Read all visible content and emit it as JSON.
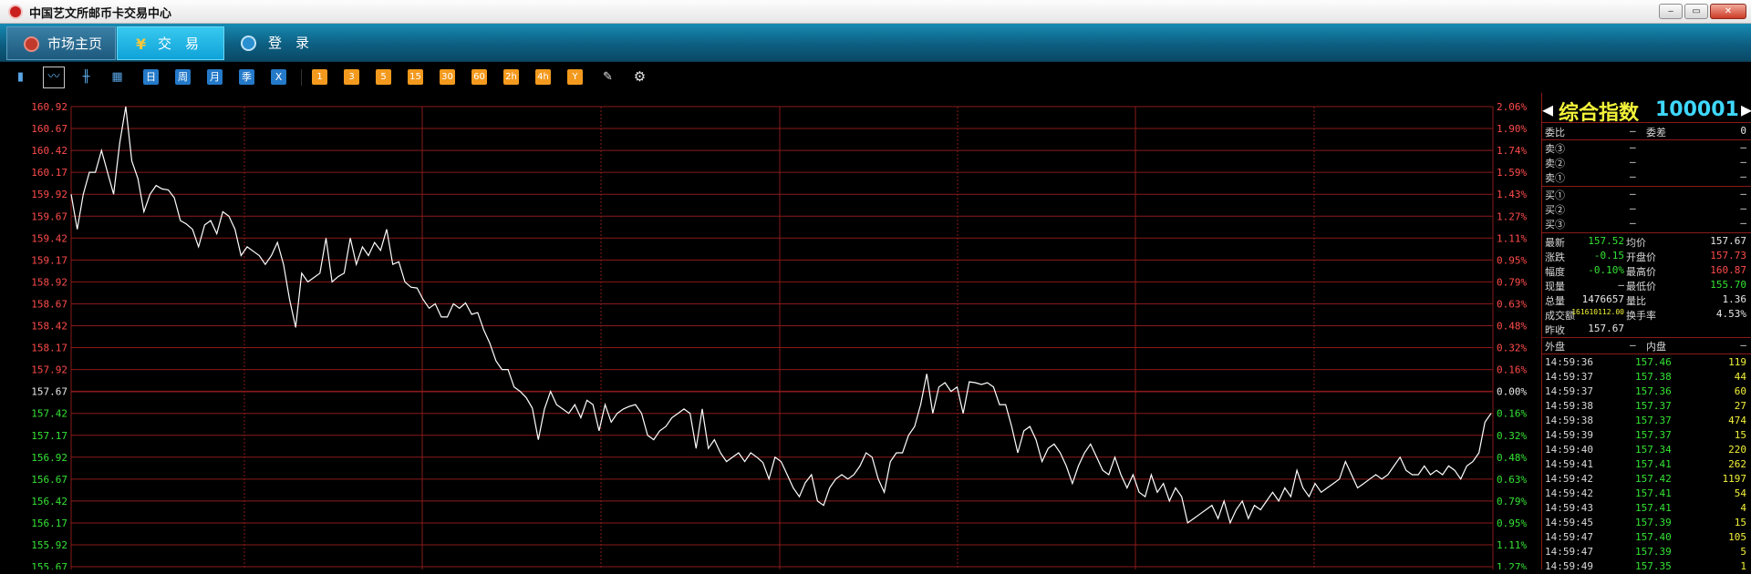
{
  "window": {
    "title": "中国艺文所邮币卡交易中心",
    "min": "‒",
    "max": "▭",
    "close": "✕"
  },
  "nav": [
    {
      "label": "市场主页",
      "icon": "home-globe-icon"
    },
    {
      "label": "交易",
      "icon": "yen-icon"
    },
    {
      "label": "登录",
      "icon": "user-icon"
    }
  ],
  "toolbar": {
    "period_buttons": [
      "日",
      "周",
      "月",
      "季",
      "X"
    ],
    "minute_buttons": [
      "1",
      "3",
      "5",
      "15",
      "30",
      "60",
      "2h",
      "4h",
      "Y"
    ]
  },
  "chart_data": {
    "type": "line",
    "baseline": 157.67,
    "y_labels_left": [
      "160.92",
      "160.67",
      "160.42",
      "160.17",
      "159.92",
      "159.67",
      "159.42",
      "159.17",
      "158.92",
      "158.67",
      "158.42",
      "158.17",
      "157.92",
      "157.67",
      "157.42",
      "157.17",
      "156.92",
      "156.67",
      "156.42",
      "156.17",
      "155.92",
      "155.67"
    ],
    "y_labels_right": [
      "2.06%",
      "1.90%",
      "1.74%",
      "1.59%",
      "1.43%",
      "1.27%",
      "1.11%",
      "0.95%",
      "0.79%",
      "0.63%",
      "0.48%",
      "0.32%",
      "0.16%",
      "0.00%",
      "0.16%",
      "0.32%",
      "0.48%",
      "0.63%",
      "0.79%",
      "0.95%",
      "1.11%",
      "1.27%"
    ],
    "ylim": [
      155.67,
      160.92
    ],
    "colors": {
      "up": "#ff4b4b",
      "down": "#35e335",
      "flat": "#e8e8e8",
      "line": "#ffffff",
      "grid": "#8a1a1a"
    },
    "series": [
      {
        "values": [
          159.92,
          159.52,
          159.92,
          160.17,
          160.17,
          160.42,
          160.17,
          159.92,
          160.5,
          160.92,
          160.3,
          160.1,
          159.72,
          159.92,
          160.02,
          159.98,
          159.97,
          159.88,
          159.62,
          159.58,
          159.52,
          159.32,
          159.57,
          159.62,
          159.47,
          159.72,
          159.67,
          159.52,
          159.22,
          159.32,
          159.27,
          159.22,
          159.12,
          159.22,
          159.37,
          159.12,
          158.72,
          158.4,
          159.02,
          158.92,
          158.97,
          159.02,
          159.42,
          158.92,
          158.98,
          159.02,
          159.42,
          159.12,
          159.32,
          159.22,
          159.37,
          159.28,
          159.52,
          159.12,
          159.15,
          158.92,
          158.86,
          158.85,
          158.72,
          158.62,
          158.67,
          158.52,
          158.52,
          158.67,
          158.62,
          158.68,
          158.55,
          158.57,
          158.37,
          158.22,
          158.02,
          157.92,
          157.92,
          157.72,
          157.67,
          157.6,
          157.48,
          157.12,
          157.47,
          157.67,
          157.52,
          157.47,
          157.42,
          157.52,
          157.37,
          157.57,
          157.52,
          157.22,
          157.52,
          157.32,
          157.42,
          157.47,
          157.5,
          157.52,
          157.42,
          157.17,
          157.12,
          157.22,
          157.27,
          157.37,
          157.42,
          157.47,
          157.42,
          157.02,
          157.47,
          157.02,
          157.12,
          156.97,
          156.87,
          156.92,
          156.97,
          156.87,
          156.97,
          156.92,
          156.86,
          156.67,
          156.92,
          156.87,
          156.72,
          156.57,
          156.47,
          156.63,
          156.72,
          156.42,
          156.37,
          156.57,
          156.67,
          156.72,
          156.67,
          156.72,
          156.82,
          156.97,
          156.92,
          156.67,
          156.52,
          156.87,
          156.97,
          156.97,
          157.17,
          157.27,
          157.52,
          157.87,
          157.42,
          157.72,
          157.77,
          157.67,
          157.72,
          157.42,
          157.78,
          157.77,
          157.75,
          157.77,
          157.72,
          157.52,
          157.52,
          157.27,
          156.97,
          157.22,
          157.27,
          157.12,
          156.87,
          157.02,
          157.07,
          156.97,
          156.82,
          156.62,
          156.82,
          156.97,
          157.07,
          156.92,
          156.77,
          156.72,
          156.92,
          156.72,
          156.57,
          156.72,
          156.52,
          156.47,
          156.72,
          156.52,
          156.62,
          156.42,
          156.57,
          156.47,
          156.17,
          156.22,
          156.27,
          156.32,
          156.37,
          156.22,
          156.42,
          156.17,
          156.32,
          156.42,
          156.22,
          156.37,
          156.32,
          156.42,
          156.52,
          156.42,
          156.57,
          156.47,
          156.77,
          156.57,
          156.47,
          156.62,
          156.52,
          156.57,
          156.62,
          156.67,
          156.87,
          156.72,
          156.57,
          156.62,
          156.67,
          156.72,
          156.67,
          156.72,
          156.82,
          156.92,
          156.77,
          156.72,
          156.72,
          156.82,
          156.72,
          156.77,
          156.72,
          156.82,
          156.77,
          156.67,
          156.82,
          156.87,
          156.97,
          157.32,
          157.42
        ]
      }
    ]
  },
  "quote": {
    "name": "综合指数",
    "code": "100001",
    "wei_bi": {
      "label": "委比",
      "value": "—"
    },
    "wei_cha": {
      "label": "委差",
      "value": "0"
    },
    "sell": [
      {
        "label": "卖③",
        "price": "—",
        "vol": "—"
      },
      {
        "label": "卖②",
        "price": "—",
        "vol": "—"
      },
      {
        "label": "卖①",
        "price": "—",
        "vol": "—"
      }
    ],
    "buy": [
      {
        "label": "买①",
        "price": "—",
        "vol": "—"
      },
      {
        "label": "买②",
        "price": "—",
        "vol": "—"
      },
      {
        "label": "买③",
        "price": "—",
        "vol": "—"
      }
    ],
    "stats": [
      {
        "l1": "最新",
        "v1": "157.52",
        "c1": "green",
        "l2": "均价",
        "v2": "157.67",
        "c2": "white"
      },
      {
        "l1": "涨跌",
        "v1": "-0.15",
        "c1": "green",
        "l2": "开盘价",
        "v2": "157.73",
        "c2": "red"
      },
      {
        "l1": "幅度",
        "v1": "-0.10%",
        "c1": "green",
        "l2": "最高价",
        "v2": "160.87",
        "c2": "red"
      },
      {
        "l1": "现量",
        "v1": "—",
        "c1": "white",
        "l2": "最低价",
        "v2": "155.70",
        "c2": "green"
      },
      {
        "l1": "总量",
        "v1": "1476657",
        "c1": "white",
        "l2": "量比",
        "v2": "1.36",
        "c2": "white"
      },
      {
        "l1": "成交额",
        "v1": "161610112.00",
        "c1": "yellow",
        "l2": "换手率",
        "v2": "4.53%",
        "c2": "white"
      },
      {
        "l1": "昨收",
        "v1": "157.67",
        "c1": "white",
        "l2": "",
        "v2": "",
        "c2": "white"
      }
    ],
    "outer": {
      "label": "外盘",
      "value": "—"
    },
    "inner": {
      "label": "内盘",
      "value": "—"
    },
    "ticks": [
      {
        "time": "14:59:36",
        "price": "157.46",
        "vol": "119"
      },
      {
        "time": "14:59:37",
        "price": "157.38",
        "vol": "44"
      },
      {
        "time": "14:59:37",
        "price": "157.36",
        "vol": "60"
      },
      {
        "time": "14:59:38",
        "price": "157.37",
        "vol": "27"
      },
      {
        "time": "14:59:38",
        "price": "157.37",
        "vol": "474"
      },
      {
        "time": "14:59:39",
        "price": "157.37",
        "vol": "15"
      },
      {
        "time": "14:59:40",
        "price": "157.34",
        "vol": "220"
      },
      {
        "time": "14:59:41",
        "price": "157.41",
        "vol": "262"
      },
      {
        "time": "14:59:42",
        "price": "157.42",
        "vol": "1197"
      },
      {
        "time": "14:59:42",
        "price": "157.41",
        "vol": "54"
      },
      {
        "time": "14:59:43",
        "price": "157.41",
        "vol": "4"
      },
      {
        "time": "14:59:45",
        "price": "157.39",
        "vol": "15"
      },
      {
        "time": "14:59:47",
        "price": "157.40",
        "vol": "105"
      },
      {
        "time": "14:59:47",
        "price": "157.39",
        "vol": "5"
      },
      {
        "time": "14:59:49",
        "price": "157.35",
        "vol": "1"
      }
    ]
  }
}
